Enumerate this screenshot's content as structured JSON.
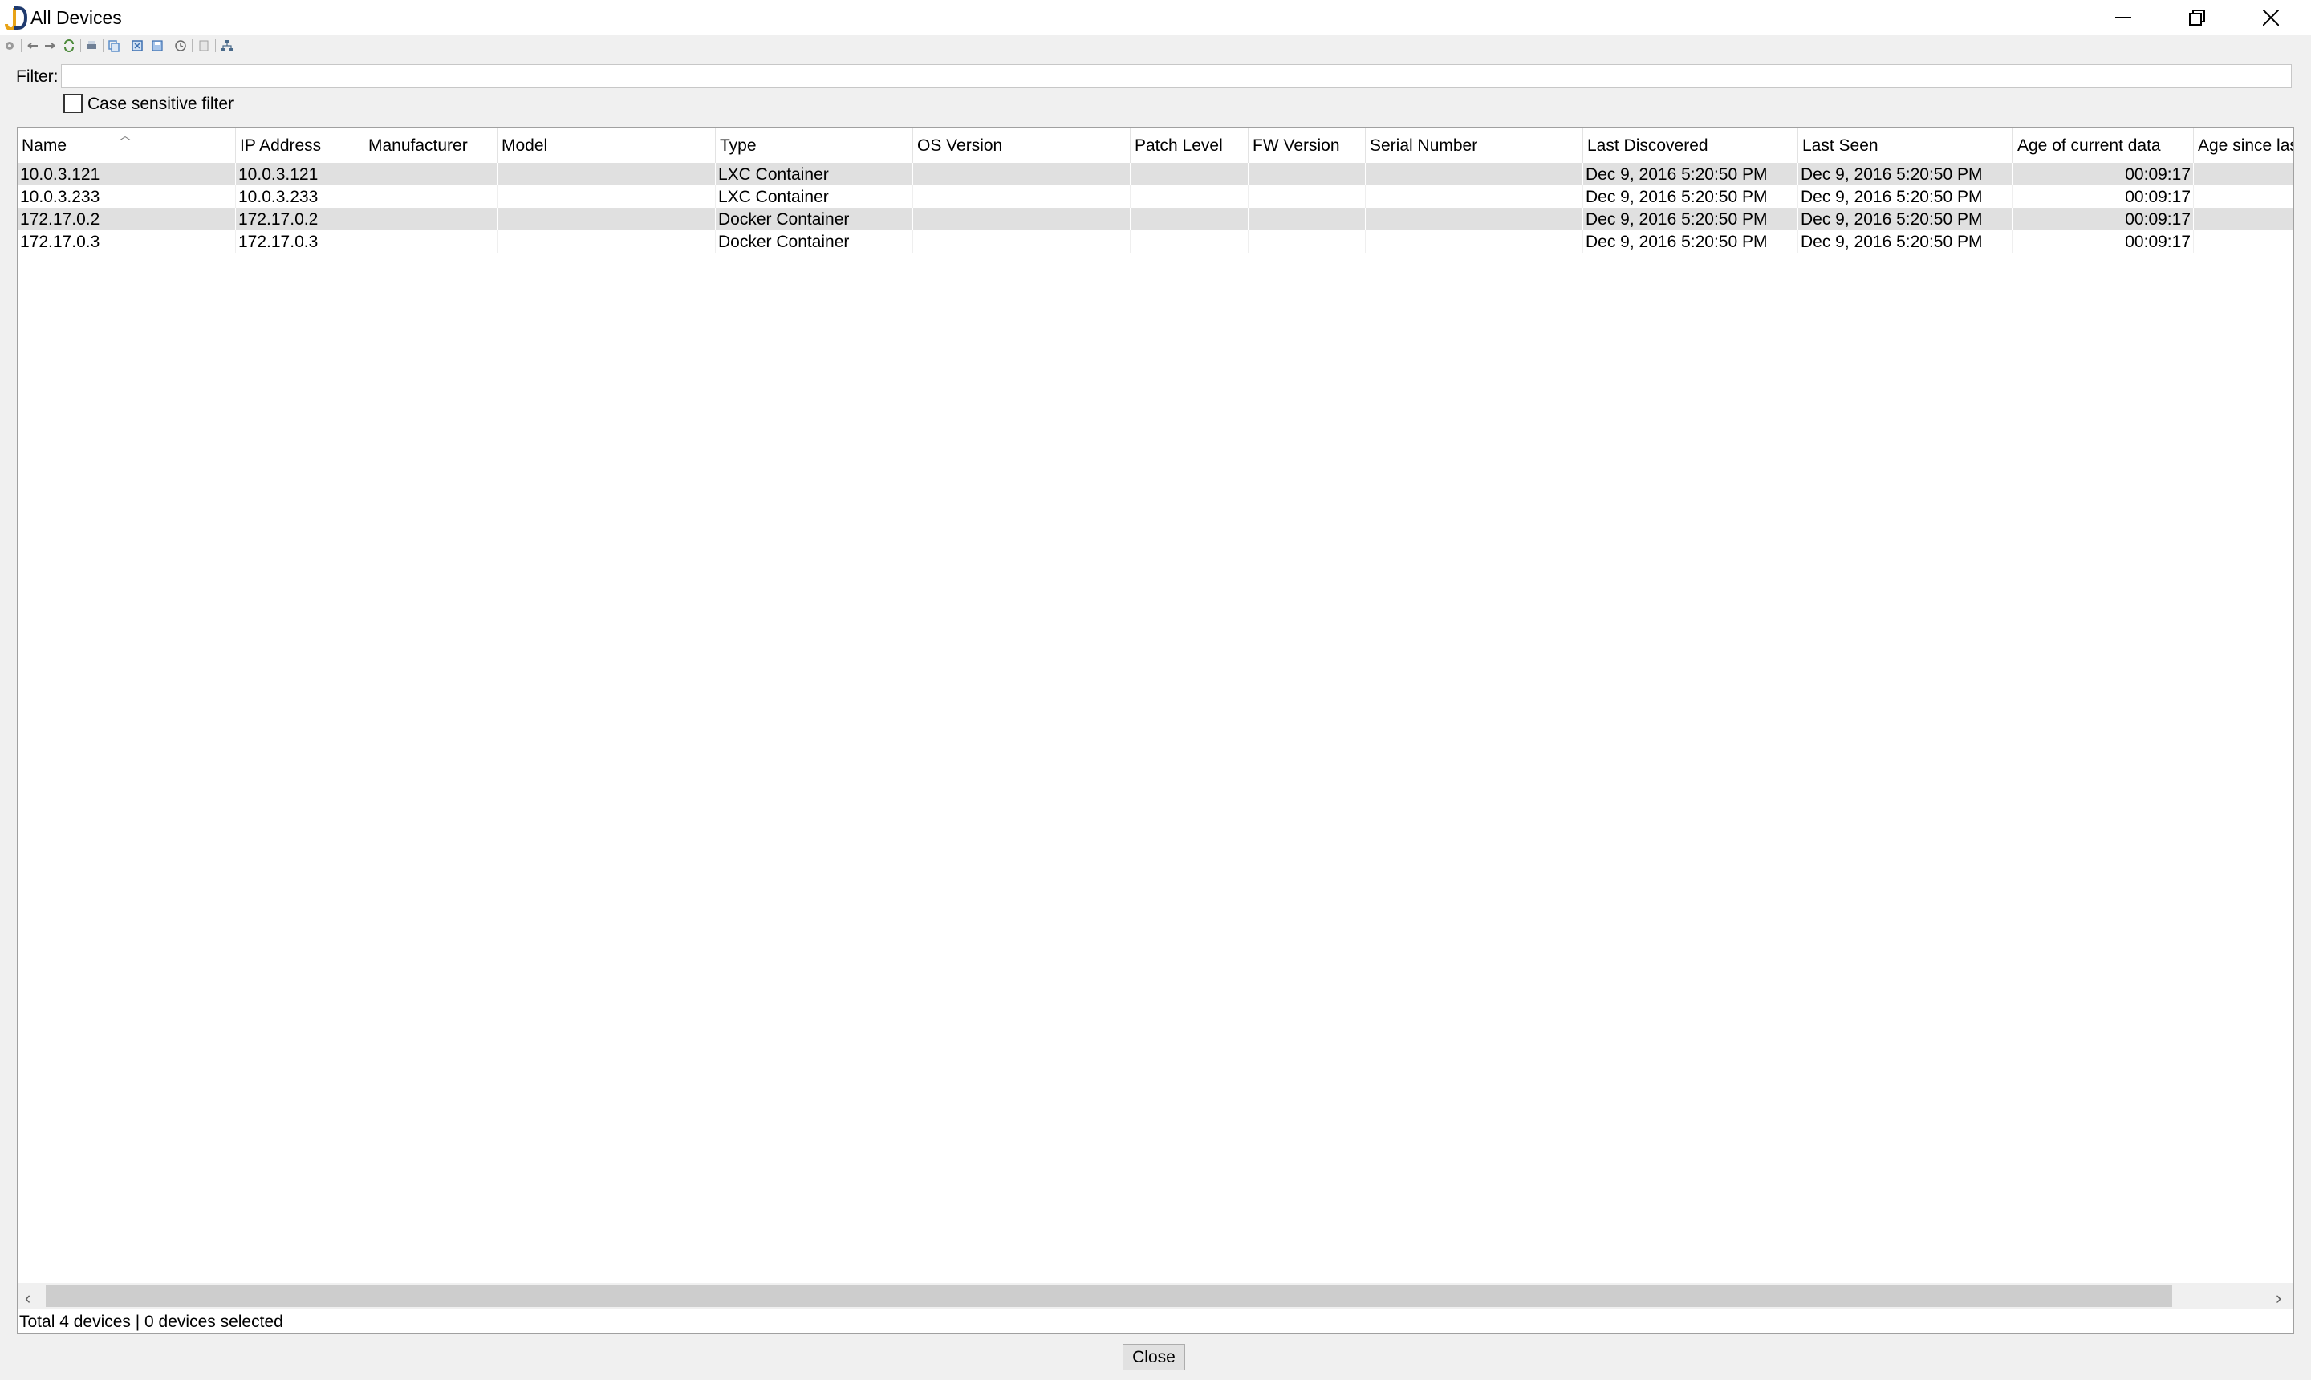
{
  "window": {
    "title": "All Devices",
    "app_icon": "jd-app-logo",
    "controls": [
      "minimize-icon",
      "restore-icon",
      "close-icon"
    ]
  },
  "toolbar": {
    "icons": [
      "settings-icon",
      "back-icon",
      "forward-icon",
      "refresh-icon",
      "print-icon",
      "copy-icon",
      "export-icon",
      "save-icon",
      "schedule-icon",
      "report-icon",
      "network-icon"
    ]
  },
  "filter": {
    "label": "Filter:",
    "value": "",
    "case_sensitive_label": "Case sensitive filter",
    "case_sensitive_checked": false
  },
  "table": {
    "columns": [
      "Name",
      "IP Address",
      "Manufacturer",
      "Model",
      "Type",
      "OS Version",
      "Patch Level",
      "FW Version",
      "Serial Number",
      "Last Discovered",
      "Last Seen",
      "Age of current data",
      "Age since last"
    ],
    "sorted_column": "Name",
    "rows": [
      [
        "10.0.3.121",
        "10.0.3.121",
        "",
        "",
        "LXC Container",
        "",
        "",
        "",
        "",
        "Dec 9, 2016 5:20:50 PM",
        "Dec 9, 2016 5:20:50 PM",
        "00:09:17",
        ""
      ],
      [
        "10.0.3.233",
        "10.0.3.233",
        "",
        "",
        "LXC Container",
        "",
        "",
        "",
        "",
        "Dec 9, 2016 5:20:50 PM",
        "Dec 9, 2016 5:20:50 PM",
        "00:09:17",
        ""
      ],
      [
        "172.17.0.2",
        "172.17.0.2",
        "",
        "",
        "Docker Container",
        "",
        "",
        "",
        "",
        "Dec 9, 2016 5:20:50 PM",
        "Dec 9, 2016 5:20:50 PM",
        "00:09:17",
        ""
      ],
      [
        "172.17.0.3",
        "172.17.0.3",
        "",
        "",
        "Docker Container",
        "",
        "",
        "",
        "",
        "Dec 9, 2016 5:20:50 PM",
        "Dec 9, 2016 5:20:50 PM",
        "00:09:17",
        ""
      ]
    ]
  },
  "status": {
    "text": "Total 4 devices | 0 devices selected"
  },
  "footer": {
    "close_label": "Close"
  }
}
